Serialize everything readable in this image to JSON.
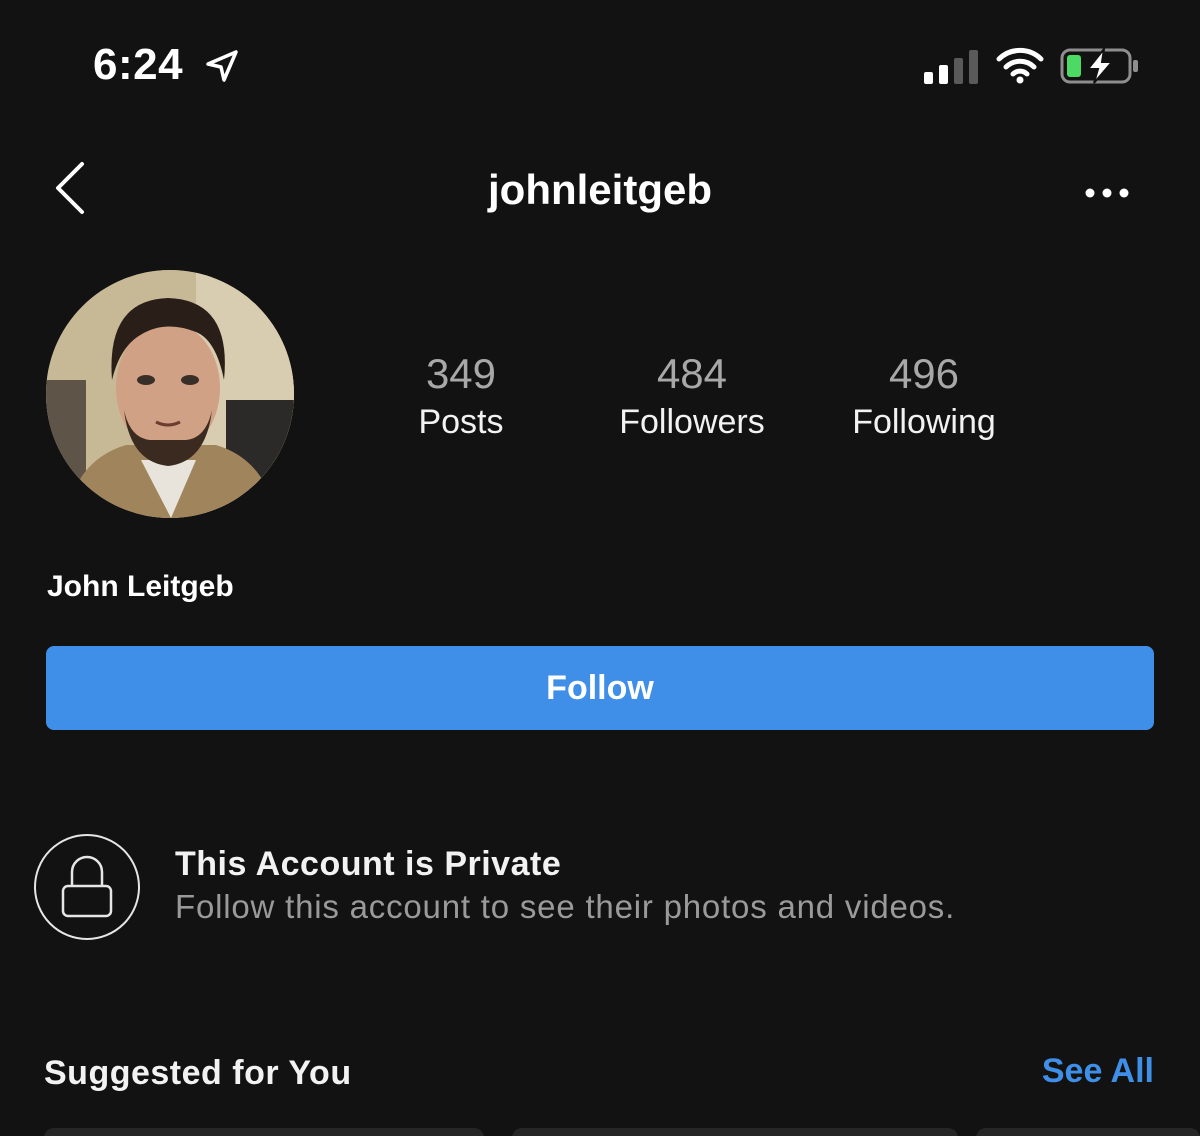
{
  "status_bar": {
    "time": "6:24",
    "icons": [
      "location-arrow-icon",
      "cellular-signal-icon",
      "wifi-icon",
      "battery-charging-icon"
    ],
    "signal_bars": 2,
    "battery_color": "#4cd964"
  },
  "nav": {
    "username": "johnleitgeb",
    "back_icon": "chevron-left-icon",
    "more_icon": "ellipsis-icon"
  },
  "profile": {
    "stats": [
      {
        "count": "349",
        "label": "Posts"
      },
      {
        "count": "484",
        "label": "Followers"
      },
      {
        "count": "496",
        "label": "Following"
      }
    ],
    "full_name": "John Leitgeb"
  },
  "actions": {
    "follow_label": "Follow",
    "accent": "#3f8fe8"
  },
  "private_notice": {
    "title": "This Account is Private",
    "subtitle": "Follow this account to see their photos and videos.",
    "icon": "lock-icon"
  },
  "suggested": {
    "title": "Suggested for You",
    "see_all": "See All"
  }
}
